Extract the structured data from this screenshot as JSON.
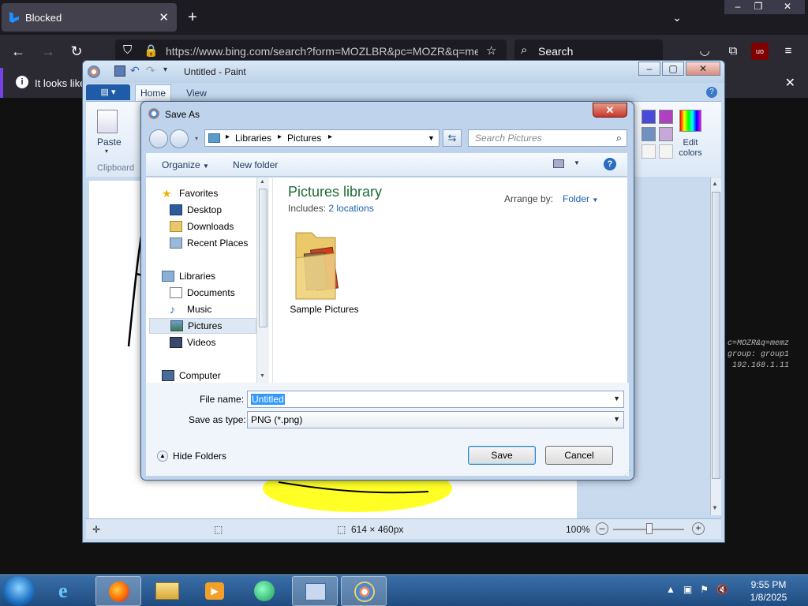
{
  "browser": {
    "tab_title": "Blocked",
    "url": "https://www.bing.com/search?form=MOZLBR&pc=MOZR&q=memz",
    "search_placeholder": "Search",
    "notification_text": "It looks like",
    "background_lines": [
      "c=MOZR&q=memz",
      "group: group1",
      "192.168.1.11"
    ]
  },
  "paint": {
    "title": "Untitled - Paint",
    "tabs": [
      "Home",
      "View"
    ],
    "paste_label": "Paste",
    "clipboard_label": "Clipboard",
    "edit_colors_label": "Edit colors",
    "status_size": "614 × 460px",
    "zoom": "100%"
  },
  "dialog": {
    "title": "Save As",
    "breadcrumb": [
      "Libraries",
      "Pictures"
    ],
    "search_placeholder": "Search Pictures",
    "organize": "Organize",
    "new_folder": "New folder",
    "favorites_header": "Favorites",
    "favorites": [
      "Desktop",
      "Downloads",
      "Recent Places"
    ],
    "libraries_header": "Libraries",
    "libraries": [
      "Documents",
      "Music",
      "Pictures",
      "Videos"
    ],
    "computer": "Computer",
    "library_title": "Pictures library",
    "includes_label": "Includes:",
    "includes_link": "2 locations",
    "arrange_label": "Arrange by:",
    "arrange_value": "Folder",
    "folder_name": "Sample Pictures",
    "file_name_label": "File name:",
    "file_name_value": "Untitled",
    "save_type_label": "Save as type:",
    "save_type_value": "PNG (*.png)",
    "hide_folders": "Hide Folders",
    "save_button": "Save",
    "cancel_button": "Cancel"
  },
  "taskbar": {
    "time": "9:55 PM",
    "date": "1/8/2025"
  }
}
